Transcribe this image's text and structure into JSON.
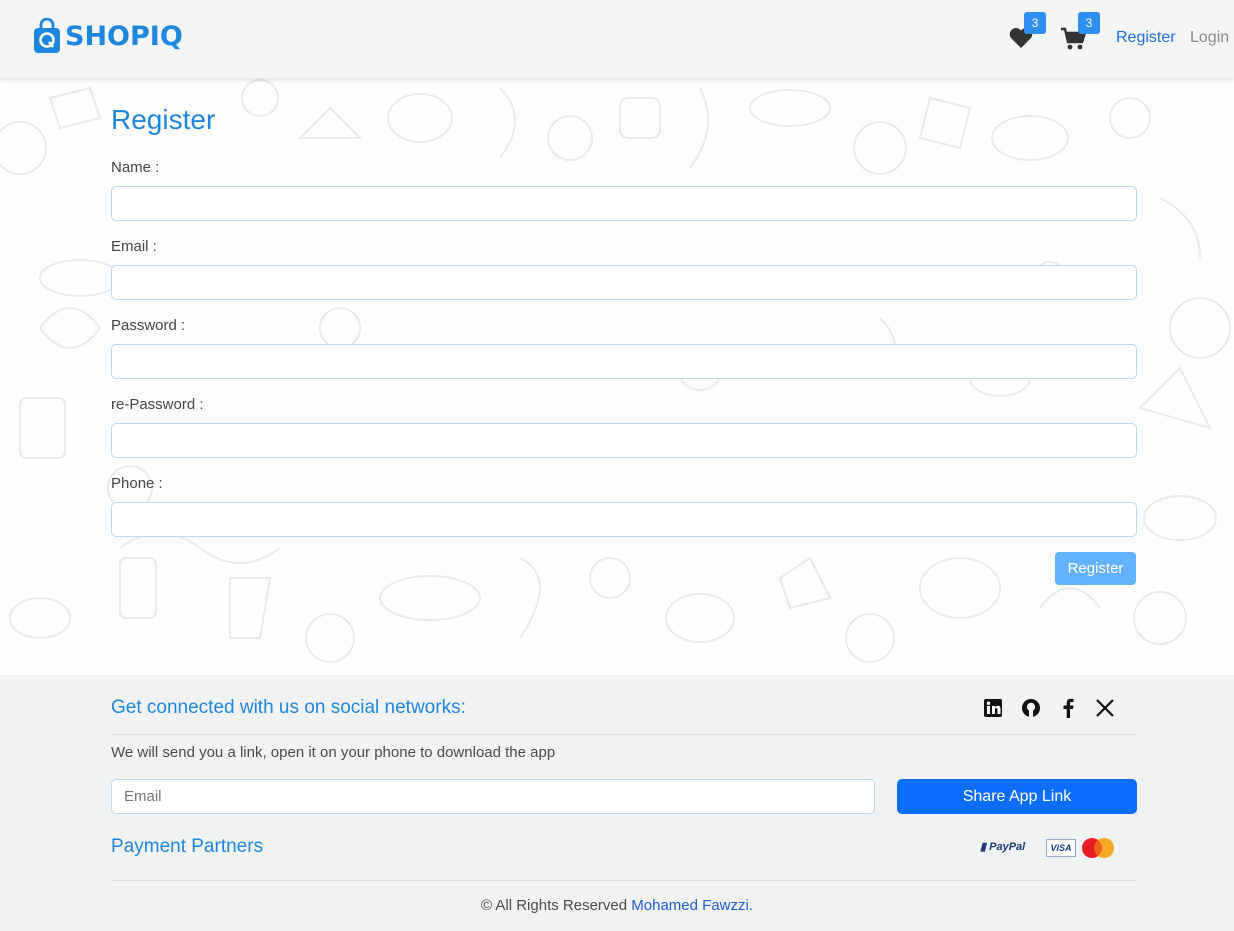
{
  "brand": {
    "name": "SHOPIQ"
  },
  "nav": {
    "wishlist_count": "3",
    "cart_count": "3",
    "register_label": "Register",
    "login_label": "Login"
  },
  "form": {
    "title": "Register",
    "fields": [
      {
        "label": "Name :",
        "value": ""
      },
      {
        "label": "Email :",
        "value": ""
      },
      {
        "label": "Password :",
        "value": ""
      },
      {
        "label": "re-Password :",
        "value": ""
      },
      {
        "label": "Phone :",
        "value": ""
      }
    ],
    "submit_label": "Register"
  },
  "footer": {
    "social_heading": "Get connected with us on social networks:",
    "social_icons": [
      "linkedin-icon",
      "github-icon",
      "facebook-icon",
      "x-icon"
    ],
    "app_text": "We will send you a link, open it on your phone to download the app",
    "email_placeholder": "Email",
    "share_label": "Share App Link",
    "payment_heading": "Payment Partners",
    "payment_partners": [
      "PayPal",
      "VISA",
      "MasterCard"
    ],
    "copyright_prefix": "© All Rights Reserved",
    "copyright_name": "Mohamed Fawzzi."
  },
  "colors": {
    "brand_blue": "#1f86dd",
    "badge_blue": "#2f8ff0",
    "primary_button": "#0d6efd",
    "register_button": "#62b2ff",
    "footer_bg": "#f1f2f2"
  }
}
